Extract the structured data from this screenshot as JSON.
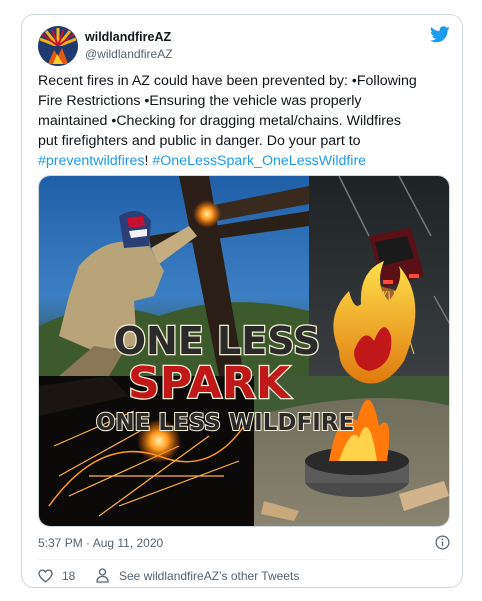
{
  "tweet": {
    "author": {
      "name": "wildlandfireAZ",
      "handle": "@wildlandfireAZ"
    },
    "text": {
      "line1": "Recent fires in AZ could have been prevented by: •Following",
      "line2": "Fire Restrictions •Ensuring the vehicle was properly",
      "line3": "maintained •Checking for dragging metal/chains. Wildfires",
      "line4": "put firefighters and public in danger. Do your part to",
      "hashtag1": "#preventwildfires",
      "between": "! ",
      "hashtag2": "#OneLessSpark_OneLessWildfire"
    },
    "media": {
      "headline": "ONE LESS",
      "highlight": "SPARK",
      "tagline": "ONE LESS WILDFIRE"
    },
    "timestamp": "5:37 PM · Aug 11, 2020",
    "likes": "18",
    "other_tweets_label": "See wildlandfireAZ’s other Tweets"
  },
  "colors": {
    "link": "#1d9bf0",
    "secondary_text": "#536471",
    "border": "#cfd9de",
    "spark_red": "#c01818"
  },
  "icons": [
    "avatar-logo",
    "twitter-bird-icon",
    "info-icon",
    "heart-icon",
    "person-icon",
    "flame-icon"
  ]
}
